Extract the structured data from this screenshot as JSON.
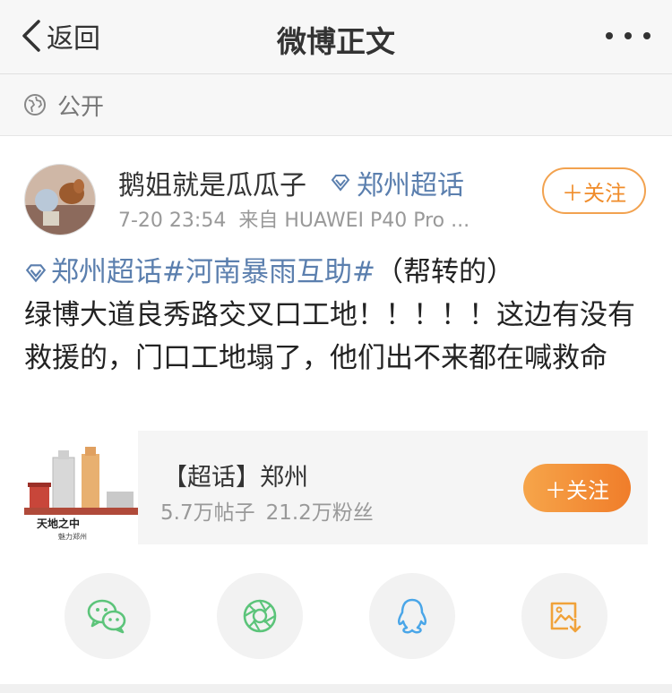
{
  "nav": {
    "back_label": "返回",
    "title": "微博正文"
  },
  "visibility": {
    "label": "公开"
  },
  "author": {
    "name": "鹅姐就是瓜瓜子",
    "topic": "郑州超话",
    "time": "7-20 23:54",
    "source": "来自 HUAWEI P40 Pro ...",
    "follow_label": "＋关注"
  },
  "post": {
    "topic_link": "郑州超话",
    "hashtag": "#河南暴雨互助#",
    "note": "（帮转的）",
    "text": "绿博大道良秀路交叉口工地！！！！！这边有没有救援的，门口工地塌了，他们出不来都在喊救命"
  },
  "card": {
    "title": "【超话】郑州",
    "posts": "5.7万帖子",
    "fans": "21.2万粉丝",
    "follow_label": "＋关注",
    "image_caption_1": "天地之中",
    "image_caption_2": "魅力郑州"
  },
  "share": [
    "wechat-icon",
    "moments-icon",
    "qq-icon",
    "save-image-icon"
  ],
  "colors": {
    "link": "#5b7fae",
    "accent": "#f08c2a"
  }
}
